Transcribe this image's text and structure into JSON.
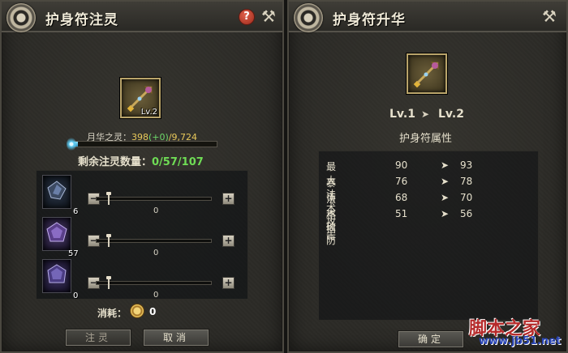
{
  "left_panel": {
    "title": "护身符注灵",
    "help_label": "?",
    "item_level": "Lv.2",
    "essence_label": "月华之灵：",
    "essence_current": "398",
    "essence_plus": "(+0)",
    "essence_max": "/9,724",
    "essence_fill_fraction": 0.04,
    "remaining_label": "剩余注灵数量：",
    "remaining_value": "0/57/107",
    "slots": [
      {
        "count": "6",
        "value": "0",
        "minus": "−",
        "plus": "+"
      },
      {
        "count": "57",
        "value": "0",
        "minus": "−",
        "plus": "+"
      },
      {
        "count": "0",
        "value": "0",
        "minus": "−",
        "plus": "+"
      }
    ],
    "cost_label": "消耗：",
    "cost_value": "0",
    "inject_button": "注灵",
    "cancel_button": "取消"
  },
  "right_panel": {
    "title": "护身符升华",
    "level_from": "Lv.1",
    "level_to": "Lv.2",
    "attr_heading": "护身符属性",
    "attributes": [
      {
        "name": "最大法术攻击",
        "old": "90",
        "new": "93"
      },
      {
        "name": "暴击",
        "old": "76",
        "new": "78"
      },
      {
        "name": "法术破防",
        "old": "68",
        "new": "70"
      },
      {
        "name": "格挡",
        "old": "51",
        "new": "56"
      }
    ],
    "confirm_button": "确定"
  },
  "watermark": {
    "text": "脚本之家",
    "url": "www.jb51.net"
  },
  "colors": {
    "essence_value": "#e8c85a",
    "green_text": "#6fdc55",
    "panel_bg": "#2d2c28"
  }
}
